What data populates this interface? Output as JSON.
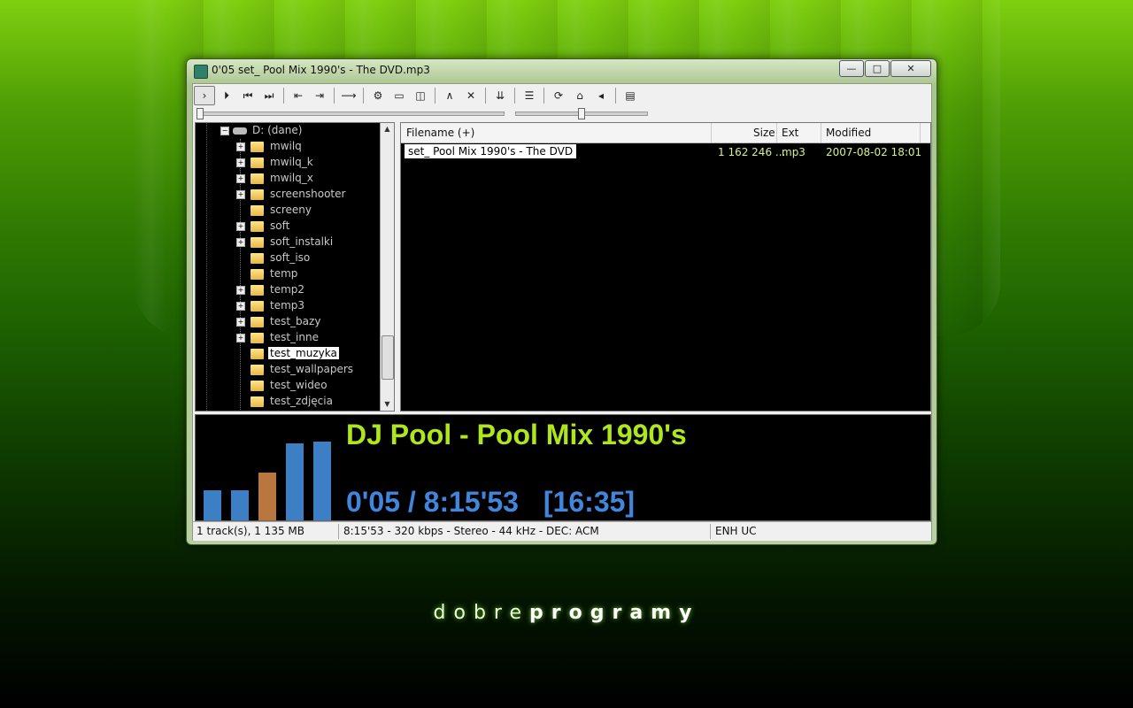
{
  "window": {
    "title": "0'05 set_ Pool Mix 1990's - The DVD.mp3"
  },
  "titlebar_buttons": {
    "minimize": "—",
    "maximize": "□",
    "close": "✕"
  },
  "toolbar": [
    {
      "name": "play-next-icon",
      "glyph": "›",
      "active": true
    },
    {
      "name": "play-icon",
      "glyph": "⏵"
    },
    {
      "name": "previous-icon",
      "glyph": "⏮"
    },
    {
      "name": "next-icon",
      "glyph": "⏭"
    },
    {
      "sep": true
    },
    {
      "name": "folder-back-icon",
      "glyph": "⇤"
    },
    {
      "name": "folder-forward-icon",
      "glyph": "⇥"
    },
    {
      "sep": true
    },
    {
      "name": "arrow-right-icon",
      "glyph": "⟶"
    },
    {
      "sep": true
    },
    {
      "name": "settings-icon",
      "glyph": "⚙"
    },
    {
      "name": "view-icon",
      "glyph": "▭"
    },
    {
      "name": "panel-icon",
      "glyph": "◫"
    },
    {
      "sep": true
    },
    {
      "name": "caret-up-icon",
      "glyph": "∧"
    },
    {
      "name": "close-icon",
      "glyph": "✕"
    },
    {
      "sep": true
    },
    {
      "name": "sort-down-icon",
      "glyph": "⇊"
    },
    {
      "sep": true
    },
    {
      "name": "layout-icon",
      "glyph": "☰"
    },
    {
      "sep": true
    },
    {
      "name": "refresh-icon",
      "glyph": "⟳"
    },
    {
      "name": "home-icon",
      "glyph": "⌂"
    },
    {
      "name": "volume-icon",
      "glyph": "◂"
    },
    {
      "sep": true
    },
    {
      "name": "playlist-icon",
      "glyph": "▤"
    }
  ],
  "tree": {
    "drive": "D: (dane)",
    "items": [
      {
        "label": "mwilq",
        "expandable": true
      },
      {
        "label": "mwilq_k",
        "expandable": true
      },
      {
        "label": "mwilq_x",
        "expandable": true
      },
      {
        "label": "screenshooter",
        "expandable": true
      },
      {
        "label": "screeny",
        "expandable": false
      },
      {
        "label": "soft",
        "expandable": true
      },
      {
        "label": "soft_instalki",
        "expandable": true
      },
      {
        "label": "soft_iso",
        "expandable": false
      },
      {
        "label": "temp",
        "expandable": false
      },
      {
        "label": "temp2",
        "expandable": true
      },
      {
        "label": "temp3",
        "expandable": true
      },
      {
        "label": "test_bazy",
        "expandable": true
      },
      {
        "label": "test_inne",
        "expandable": true
      },
      {
        "label": "test_muzyka",
        "expandable": false,
        "selected": true
      },
      {
        "label": "test_wallpapers",
        "expandable": false
      },
      {
        "label": "test_wideo",
        "expandable": false
      },
      {
        "label": "test_zdjęcia",
        "expandable": false
      }
    ],
    "expand_glyph": "+",
    "collapse_glyph": "−",
    "scroll_up": "▲",
    "scroll_down": "▼"
  },
  "filelist": {
    "headers": {
      "filename": "Filename (+)",
      "size": "Size",
      "ext": "Ext",
      "modified": "Modified"
    },
    "rows": [
      {
        "filename": "set_ Pool Mix 1990's - The DVD",
        "size": "1 162 246 ...",
        "ext": "mp3",
        "modified": "2007-08-02 18:01"
      }
    ]
  },
  "player": {
    "title": "DJ Pool - Pool Mix 1990's",
    "time": "0'05 / 8:15'53",
    "total": "[16:35]",
    "spectrum": [
      {
        "level": 0.38,
        "color": "#3d7fc4"
      },
      {
        "level": 0.38,
        "color": "#3d7fc4"
      },
      {
        "level": 0.6,
        "color": "#b9773f"
      },
      {
        "level": 0.97,
        "color": "#3d7fc4"
      },
      {
        "level": 0.99,
        "color": "#3d7fc4"
      }
    ]
  },
  "progress": {
    "position": 0.0,
    "volume": 0.5
  },
  "statusbar": {
    "tracks": "1 track(s), 1 135 MB",
    "info": "8:15'53 - 320 kbps - Stereo - 44 kHz - DEC: ACM",
    "flags": "ENH  UC"
  },
  "brand": {
    "light": "dobre",
    "bold": "programy"
  }
}
